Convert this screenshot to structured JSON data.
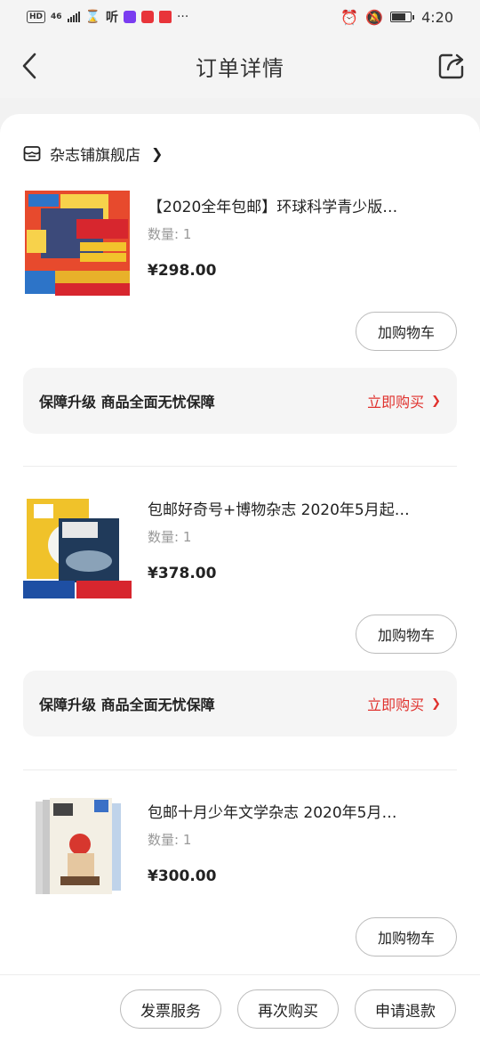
{
  "status_bar": {
    "network": "46",
    "time": "4:20",
    "battery_level": 0.8
  },
  "header": {
    "title": "订单详情"
  },
  "shop": {
    "name": "杂志铺旗舰店"
  },
  "products": [
    {
      "title": "【2020全年包邮】环球科学青少版…",
      "qty": "数量: 1",
      "price": "¥298.00",
      "cart_label": "加购物车",
      "guarantee": {
        "text": "保障升级  商品全面无忧保障",
        "link": "立即购买"
      }
    },
    {
      "title": "包邮好奇号+博物杂志 2020年5月起…",
      "qty": "数量: 1",
      "price": "¥378.00",
      "cart_label": "加购物车",
      "guarantee": {
        "text": "保障升级  商品全面无忧保障",
        "link": "立即购买"
      }
    },
    {
      "title": "包邮十月少年文学杂志 2020年5月…",
      "qty": "数量: 1",
      "price": "¥300.00",
      "cart_label": "加购物车"
    }
  ],
  "bottom_bar": {
    "invoice_label": "发票服务",
    "rebuy_label": "再次购买",
    "refund_label": "申请退款"
  },
  "colors": {
    "accent_red": "#e0322e",
    "guarantee_bg": "#f5f5f5"
  }
}
